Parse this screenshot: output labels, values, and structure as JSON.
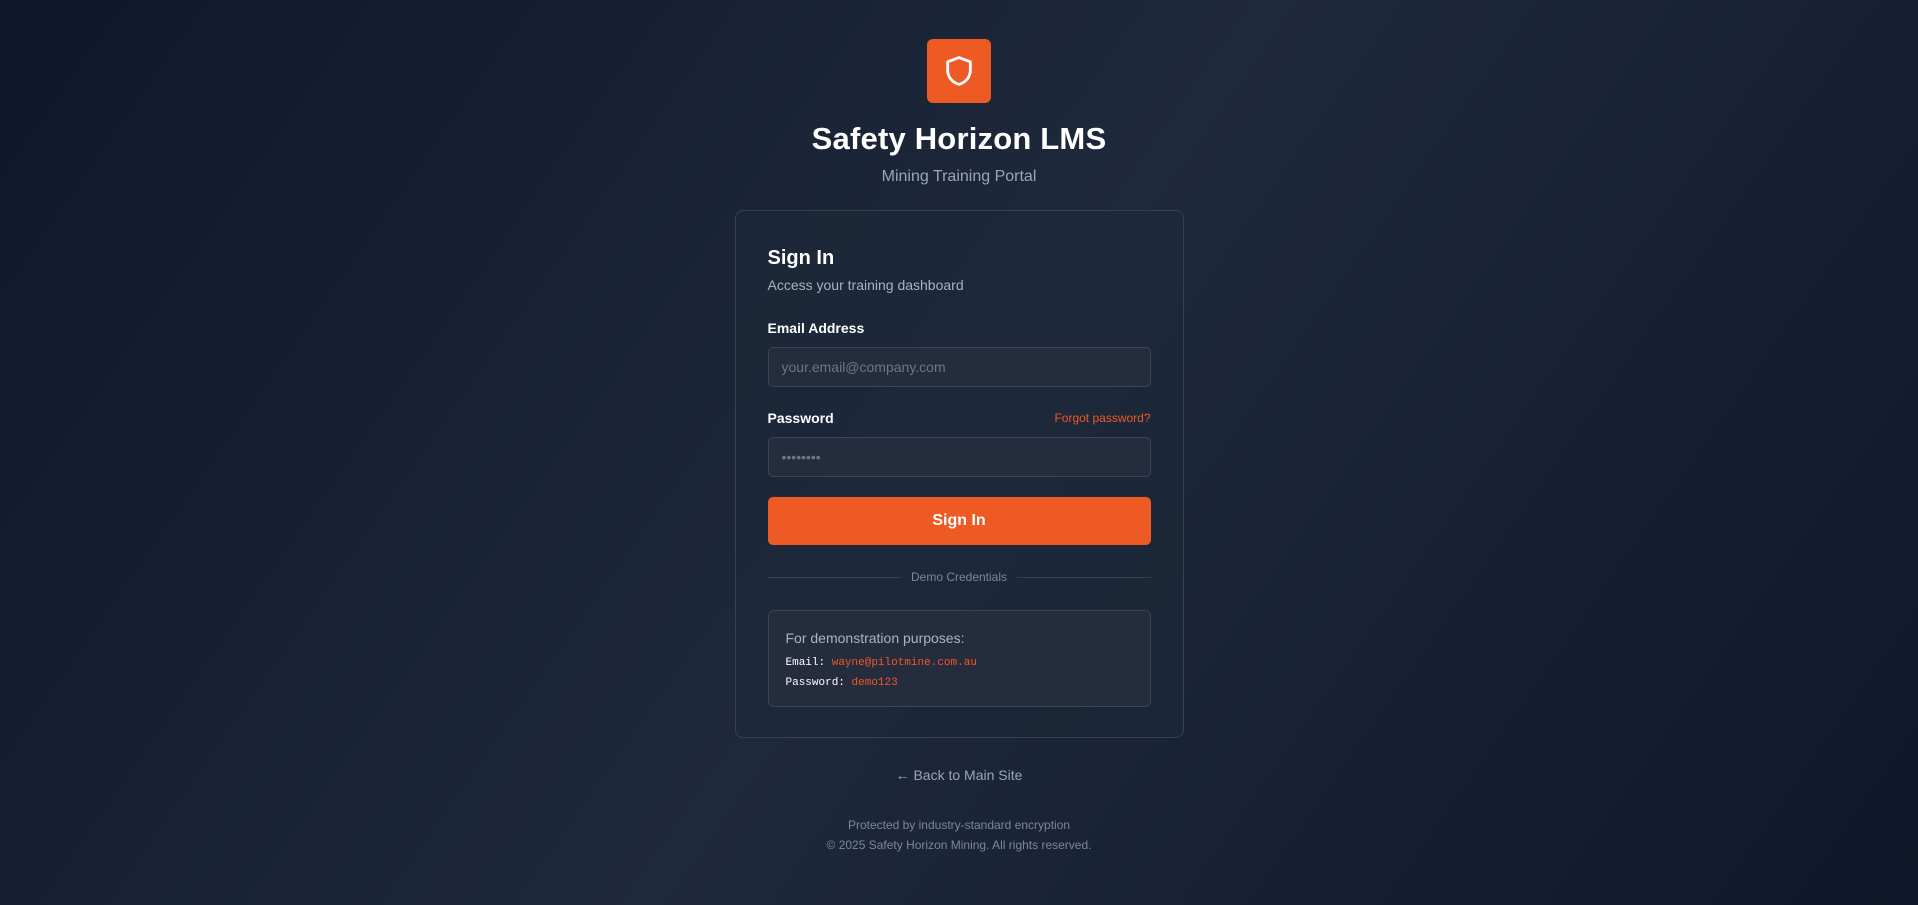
{
  "brand": {
    "logo_icon": "shield-icon",
    "accent_color": "#ee5a24",
    "title": "Safety Horizon LMS",
    "subtitle": "Mining Training Portal"
  },
  "signin_card": {
    "title": "Sign In",
    "subtitle": "Access your training dashboard",
    "email": {
      "label": "Email Address",
      "placeholder": "your.email@company.com",
      "value": ""
    },
    "password": {
      "label": "Password",
      "placeholder": "••••••••",
      "value": "",
      "forgot_label": "Forgot password?"
    },
    "submit_label": "Sign In",
    "divider_label": "Demo Credentials",
    "demo": {
      "intro": "For demonstration purposes:",
      "email_label": "Email:",
      "email_value": "wayne@pilotmine.com.au",
      "password_label": "Password:",
      "password_value": "demo123"
    }
  },
  "back_link": "← Back to Main Site",
  "footer": {
    "security_note": "Protected by industry-standard encryption",
    "copyright": "© 2025 Safety Horizon Mining. All rights reserved."
  }
}
